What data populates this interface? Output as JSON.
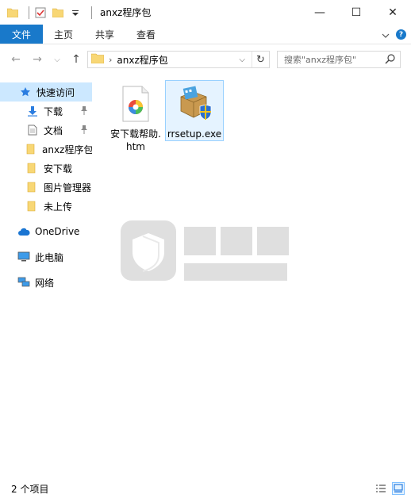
{
  "window": {
    "title": "anxz程序包",
    "minimize": "—",
    "maximize": "☐",
    "close": "✕"
  },
  "ribbon": {
    "tabs": [
      {
        "label": "文件",
        "active": true
      },
      {
        "label": "主页"
      },
      {
        "label": "共享"
      },
      {
        "label": "查看"
      }
    ]
  },
  "navbar": {
    "back": "←",
    "forward": "→",
    "recent": "⌵",
    "up": "↑",
    "path": "anxz程序包",
    "search_placeholder": "搜索\"anxz程序包\""
  },
  "sidebar": {
    "items": [
      {
        "label": "快速访问",
        "icon": "star-icon",
        "selected": true
      },
      {
        "label": "下载",
        "icon": "download-icon",
        "pinned": true
      },
      {
        "label": "文档",
        "icon": "document-icon",
        "pinned": true
      },
      {
        "label": "anxz程序包",
        "icon": "folder-icon"
      },
      {
        "label": "安下载",
        "icon": "folder-icon"
      },
      {
        "label": "图片管理器",
        "icon": "folder-icon"
      },
      {
        "label": "未上传",
        "icon": "folder-icon"
      },
      {
        "label": "OneDrive",
        "icon": "cloud-icon"
      },
      {
        "label": "此电脑",
        "icon": "computer-icon"
      },
      {
        "label": "网络",
        "icon": "network-icon"
      }
    ]
  },
  "files": [
    {
      "name": "安下载帮助.htm",
      "icon": "htm-file-icon",
      "selected": false
    },
    {
      "name": "rrsetup.exe",
      "icon": "installer-icon",
      "selected": true
    }
  ],
  "status": {
    "count": "2 个项目"
  },
  "colors": {
    "accent": "#1979ca",
    "selection": "#cce8ff",
    "folder": "#f8d775"
  }
}
